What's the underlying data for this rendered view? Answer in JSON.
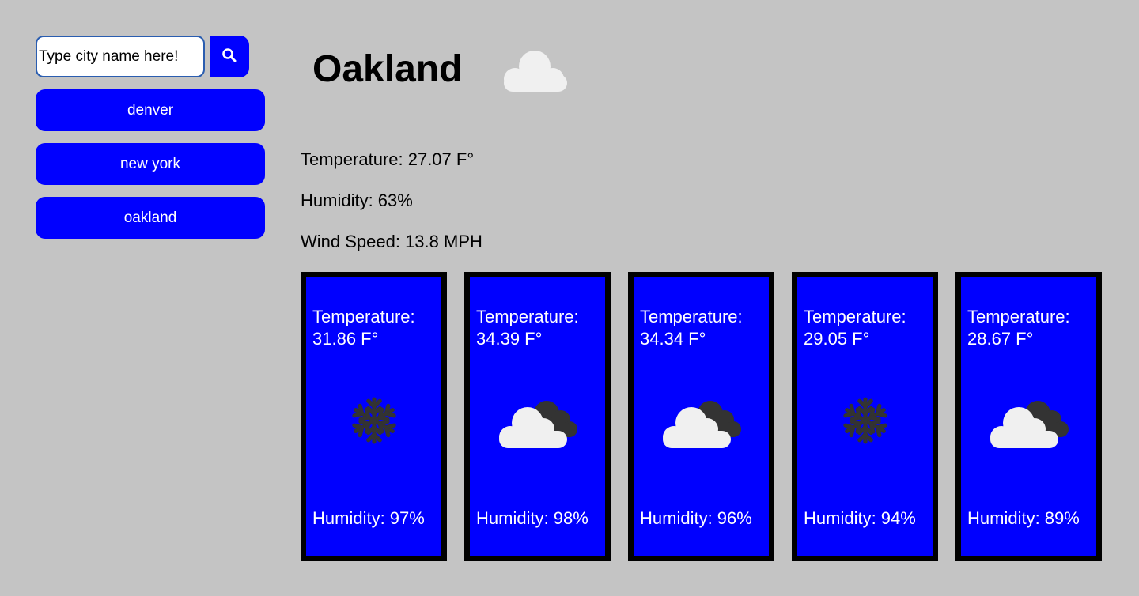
{
  "search": {
    "placeholder": "Type city name here!"
  },
  "history": [
    {
      "label": "denver"
    },
    {
      "label": "new york"
    },
    {
      "label": "oakland"
    }
  ],
  "current": {
    "city": "Oakland",
    "icon": "cloud-icon",
    "temperature": "Temperature: 27.07 F°",
    "humidity": "Humidity: 63%",
    "wind": "Wind Speed: 13.8 MPH"
  },
  "forecast": [
    {
      "temp_label": "Temperature:",
      "temp_value": "31.86 F°",
      "icon": "snowflake-icon",
      "humidity": "Humidity: 97%"
    },
    {
      "temp_label": "Temperature:",
      "temp_value": "34.39 F°",
      "icon": "cloudy-icon",
      "humidity": "Humidity: 98%"
    },
    {
      "temp_label": "Temperature:",
      "temp_value": "34.34 F°",
      "icon": "cloudy-icon",
      "humidity": "Humidity: 96%"
    },
    {
      "temp_label": "Temperature:",
      "temp_value": "29.05 F°",
      "icon": "snowflake-icon",
      "humidity": "Humidity: 94%"
    },
    {
      "temp_label": "Temperature:",
      "temp_value": "28.67 F°",
      "icon": "cloudy-icon",
      "humidity": "Humidity: 89%"
    }
  ],
  "colors": {
    "accent": "#0000ff",
    "background": "#c4c4c4",
    "card_border": "#000000"
  }
}
